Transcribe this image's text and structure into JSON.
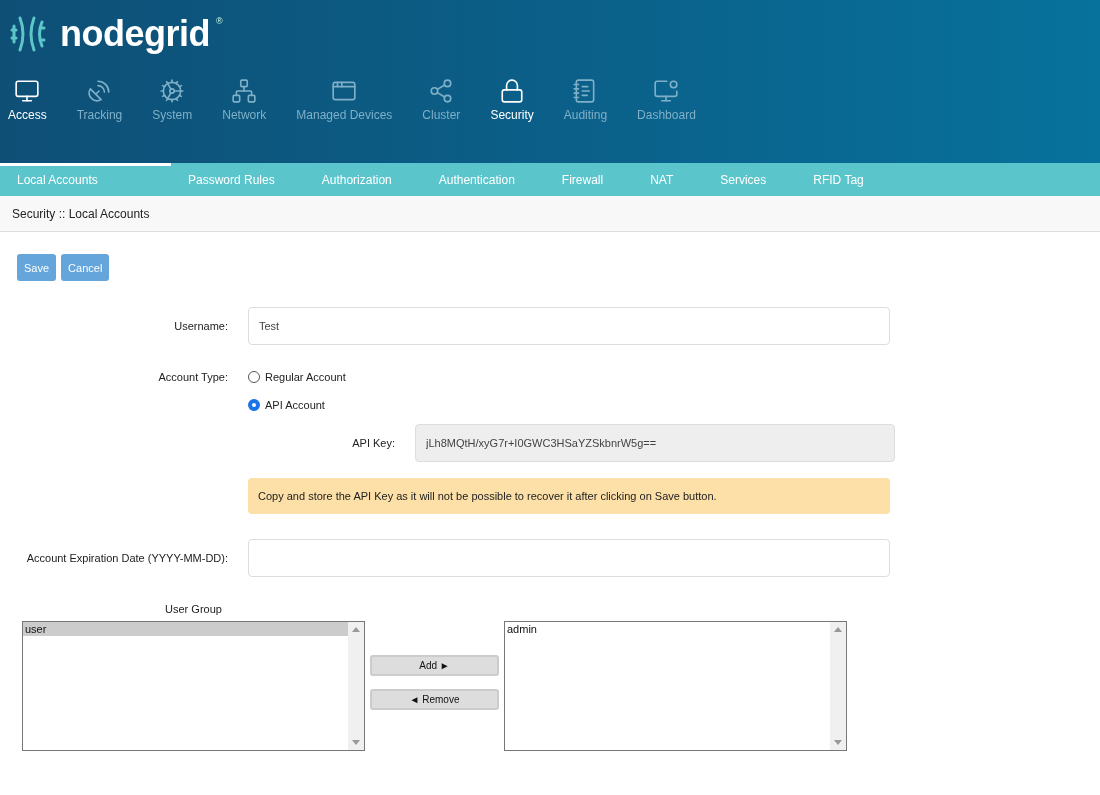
{
  "logo": {
    "name": "nodegrid",
    "mark": "®"
  },
  "main_nav": [
    {
      "label": "Access",
      "active": true
    },
    {
      "label": "Tracking",
      "active": false
    },
    {
      "label": "System",
      "active": false
    },
    {
      "label": "Network",
      "active": false
    },
    {
      "label": "Managed Devices",
      "active": false
    },
    {
      "label": "Cluster",
      "active": false
    },
    {
      "label": "Security",
      "active": true
    },
    {
      "label": "Auditing",
      "active": false
    },
    {
      "label": "Dashboard",
      "active": false
    }
  ],
  "sub_nav": [
    {
      "label": "Local Accounts",
      "selected": true
    },
    {
      "label": "Password Rules",
      "selected": false
    },
    {
      "label": "Authorization",
      "selected": false
    },
    {
      "label": "Authentication",
      "selected": false
    },
    {
      "label": "Firewall",
      "selected": false
    },
    {
      "label": "NAT",
      "selected": false
    },
    {
      "label": "Services",
      "selected": false
    },
    {
      "label": "RFID Tag",
      "selected": false
    }
  ],
  "breadcrumb": "Security :: Local Accounts",
  "buttons": [
    "Save",
    "Cancel"
  ],
  "form": {
    "username": {
      "label": "Username:",
      "value": "Test"
    },
    "account_type": {
      "label": "Account Type:",
      "options": [
        {
          "label": "Regular Account",
          "selected": false
        },
        {
          "label": "API Account",
          "selected": true
        }
      ]
    },
    "api_key": {
      "label": "API Key:",
      "value": "jLh8MQtH/xyG7r+I0GWC3HSaYZSkbnrW5g=="
    },
    "warning": "Copy and store the API Key as it will not be possible to recover it after clicking on Save button.",
    "expiration": {
      "label": "Account Expiration Date (YYYY-MM-DD):"
    }
  },
  "user_group": {
    "label": "User Group",
    "available": [
      {
        "label": "user",
        "selected": true
      }
    ],
    "add_button": "Add ►",
    "remove_button": "◄ Remove",
    "assigned": [
      {
        "label": "admin",
        "selected": false
      }
    ]
  }
}
